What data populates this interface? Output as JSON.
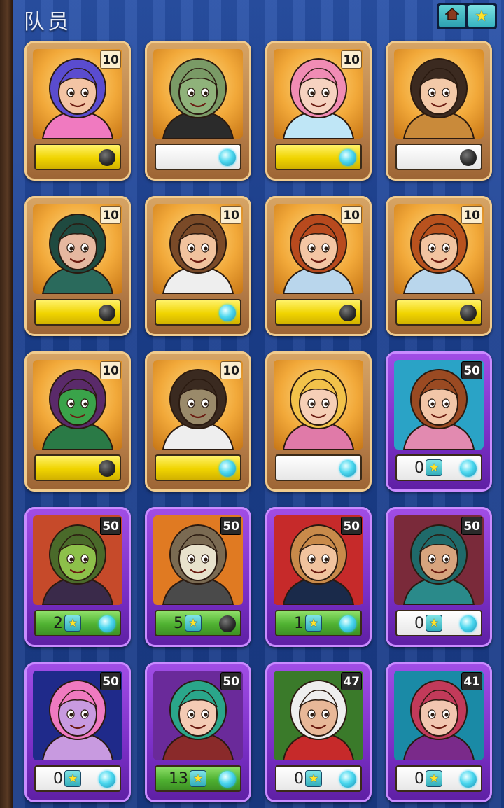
{
  "header": {
    "title": "队员",
    "home_icon": "home-icon",
    "star_icon": "star-icon"
  },
  "colors": {
    "gold_frame": "#c08a50",
    "purple_frame": "#8a3fd6",
    "yellow_bar": "#f0d400",
    "green_bar": "#4fb131",
    "orb_on": "#4cd8ef",
    "orb_off": "#2c2c2c"
  },
  "cards": [
    {
      "level": "10",
      "frame": "gold",
      "bar": "yellow",
      "orb": "off",
      "stars": null,
      "character": "unicorn-hat-girl",
      "bg": "#ffcf6a",
      "skin": "#f3c4a4",
      "hair": "#5a4ccf",
      "outfit": "#f07ac0"
    },
    {
      "level": "",
      "frame": "gold",
      "bar": "white",
      "orb": "on",
      "stars": null,
      "character": "green-ogre-sunglasses",
      "bg": "#ffcf6a",
      "skin": "#8fb27a",
      "hair": "#7a9a66",
      "outfit": "#2b2b2b"
    },
    {
      "level": "10",
      "frame": "gold",
      "bar": "yellow",
      "orb": "on",
      "stars": null,
      "character": "pink-haired-elf",
      "bg": "#ffcf6a",
      "skin": "#f6d2c0",
      "hair": "#f08cb4",
      "outfit": "#bfe6f6"
    },
    {
      "level": "",
      "frame": "gold",
      "bar": "white",
      "orb": "off",
      "stars": null,
      "character": "curly-girl-with-cat",
      "bg": "#ffcf6a",
      "skin": "#f3c9a8",
      "hair": "#3b2a20",
      "outfit": "#c98a3a"
    },
    {
      "level": "10",
      "frame": "gold",
      "bar": "yellow",
      "orb": "off",
      "stars": null,
      "character": "hooded-ninja",
      "bg": "#ffcf6a",
      "skin": "#e6b8a0",
      "hair": "#1f4a40",
      "outfit": "#2a6a5c"
    },
    {
      "level": "10",
      "frame": "gold",
      "bar": "yellow",
      "orb": "on",
      "stars": null,
      "character": "nerd-with-glasses",
      "bg": "#ffcf6a",
      "skin": "#f1c39e",
      "hair": "#7a4a28",
      "outfit": "#eeeeee"
    },
    {
      "level": "10",
      "frame": "gold",
      "bar": "yellow",
      "orb": "off",
      "stars": null,
      "character": "curly-red-boy",
      "bg": "#ffcf6a",
      "skin": "#f4c6a4",
      "hair": "#b84a1e",
      "outfit": "#b9d6ec"
    },
    {
      "level": "10",
      "frame": "gold",
      "bar": "yellow",
      "orb": "off",
      "stars": null,
      "character": "bearded-red-man",
      "bg": "#ffcf6a",
      "skin": "#f2c4a0",
      "hair": "#b8521e",
      "outfit": "#b9d6ec"
    },
    {
      "level": "10",
      "frame": "gold",
      "bar": "yellow",
      "orb": "off",
      "stars": null,
      "character": "green-goblin-girl-keys",
      "bg": "#ffcf6a",
      "skin": "#3aa34a",
      "hair": "#5a2a6a",
      "outfit": "#2a7a46"
    },
    {
      "level": "10",
      "frame": "gold",
      "bar": "yellow",
      "orb": "on",
      "stars": null,
      "character": "zombie-man",
      "bg": "#ffcf6a",
      "skin": "#9a8a6a",
      "hair": "#3a2a20",
      "outfit": "#eeeeee"
    },
    {
      "level": "",
      "frame": "gold",
      "bar": "white",
      "orb": "on",
      "stars": null,
      "character": "blonde-girl",
      "bg": "#ffcf6a",
      "skin": "#f6cfb6",
      "hair": "#f2c24a",
      "outfit": "#e07aa8"
    },
    {
      "level": "50",
      "frame": "purple",
      "bar": "white",
      "orb": "on",
      "stars": "0",
      "character": "brown-haired-girl",
      "bg": "#2aa3c6",
      "skin": "#f2c6a8",
      "hair": "#9a4a22",
      "outfit": "#e28ab0"
    },
    {
      "level": "50",
      "frame": "purple",
      "bar": "green",
      "orb": "on",
      "stars": "2",
      "character": "bat-winged-goblin",
      "bg": "#c64a2a",
      "skin": "#8dc04a",
      "hair": "#4a6a2a",
      "outfit": "#3a2a4a"
    },
    {
      "level": "50",
      "frame": "purple",
      "bar": "green",
      "orb": "off",
      "stars": "5",
      "character": "skeleton-with-axe",
      "bg": "#e07a22",
      "skin": "#e8e2cc",
      "hair": "#7a6a52",
      "outfit": "#4a4a4a"
    },
    {
      "level": "50",
      "frame": "purple",
      "bar": "green",
      "orb": "on",
      "stars": "1",
      "character": "mustached-gentleman",
      "bg": "#c62a2a",
      "skin": "#f1c39e",
      "hair": "#c88a4a",
      "outfit": "#1a2a4a"
    },
    {
      "level": "50",
      "frame": "purple",
      "bar": "white",
      "orb": "on",
      "stars": "0",
      "character": "turbaned-sage",
      "bg": "#7a2a3a",
      "skin": "#d7a47e",
      "hair": "#1f6a6a",
      "outfit": "#2a8a8a"
    },
    {
      "level": "50",
      "frame": "purple",
      "bar": "white",
      "orb": "on",
      "stars": "0",
      "character": "purple-unicorn",
      "bg": "#1f2a8a",
      "skin": "#c89ae0",
      "hair": "#f07ac0",
      "outfit": "#c89ae0"
    },
    {
      "level": "50",
      "frame": "purple",
      "bar": "green",
      "orb": "on",
      "stars": "13",
      "character": "teal-haired-elf",
      "bg": "#6a2a9a",
      "skin": "#f4cbb4",
      "hair": "#2aa68a",
      "outfit": "#8a2a2a"
    },
    {
      "level": "47",
      "frame": "purple",
      "bar": "white",
      "orb": "on",
      "stars": "0",
      "character": "santa-wizard",
      "bg": "#3a7a2a",
      "skin": "#e8b898",
      "hair": "#eeeeee",
      "outfit": "#c62a2a"
    },
    {
      "level": "41",
      "frame": "purple",
      "bar": "white",
      "orb": "on",
      "stars": "0",
      "character": "potion-elf",
      "bg": "#1a8aa6",
      "skin": "#f2c6b0",
      "hair": "#c23a5a",
      "outfit": "#7a2a8a"
    }
  ]
}
